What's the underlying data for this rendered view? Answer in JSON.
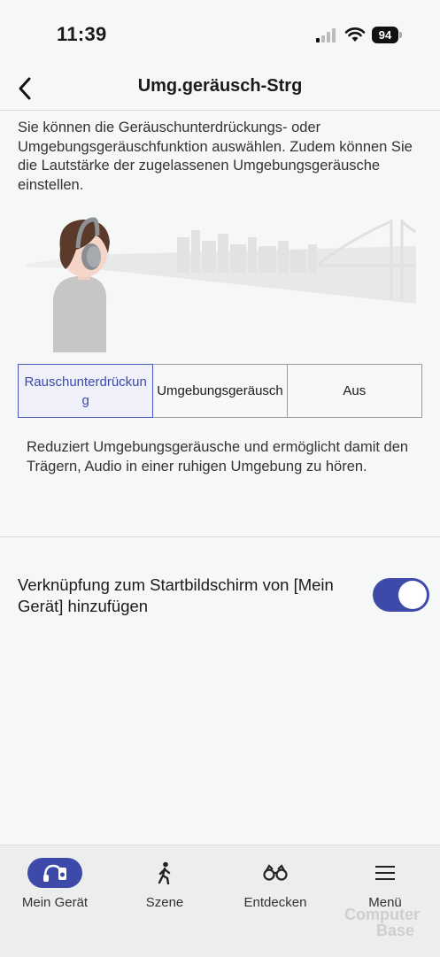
{
  "status_bar": {
    "time": "11:39",
    "battery": "94"
  },
  "header": {
    "title": "Umg.geräusch-Strg",
    "back_icon": "chevron-left-icon"
  },
  "intro_text": "Sie können die Geräuschunterdrückungs- oder Umgebungsgeräuschfunktion auswählen. Zudem können Sie die Lautstärke der zugelassenen Umgebungsgeräusche einstellen.",
  "modes": {
    "options": [
      "Rauschunterdrückung",
      "Umgebungsgeräusch",
      "Aus"
    ],
    "selected": "Rauschunterdrückung",
    "description": "Reduziert Umgebungsgeräusche und ermöglicht damit den Trägern, Audio in einer ruhigen Umgebung zu hören."
  },
  "shortcut": {
    "label": "Verknüpfung zum Startbildschirm von [Mein Gerät] hinzufügen",
    "enabled": true
  },
  "nav": {
    "items": [
      {
        "label": "Mein Gerät",
        "icon": "headphones-device-icon",
        "active": true
      },
      {
        "label": "Szene",
        "icon": "walking-person-icon",
        "active": false
      },
      {
        "label": "Entdecken",
        "icon": "binoculars-icon",
        "active": false
      },
      {
        "label": "Menü",
        "icon": "hamburger-menu-icon",
        "active": false
      }
    ]
  },
  "watermark": {
    "line1": "Computer",
    "line2": "Base"
  },
  "colors": {
    "accent": "#3d4aa9",
    "selected_bg": "#eff0fa",
    "background": "#f6f7f7",
    "nav_bg": "#eceded"
  }
}
